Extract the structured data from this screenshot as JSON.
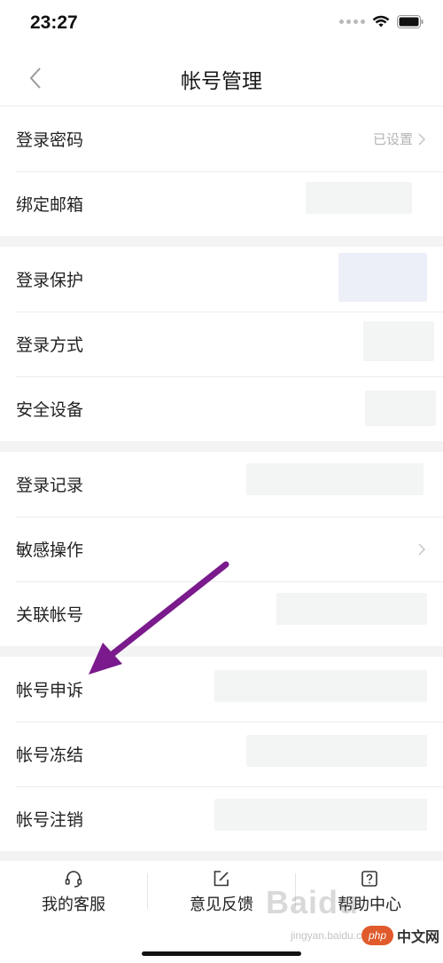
{
  "status_bar": {
    "time": "23:27"
  },
  "nav": {
    "title": "帐号管理"
  },
  "groups": [
    {
      "rows": [
        {
          "label": "登录密码",
          "value": "已设置"
        },
        {
          "label": "绑定邮箱"
        }
      ]
    },
    {
      "rows": [
        {
          "label": "登录保护"
        },
        {
          "label": "登录方式"
        },
        {
          "label": "安全设备"
        }
      ]
    },
    {
      "rows": [
        {
          "label": "登录记录"
        },
        {
          "label": "敏感操作"
        },
        {
          "label": "关联帐号"
        }
      ]
    },
    {
      "rows": [
        {
          "label": "帐号申诉"
        },
        {
          "label": "帐号冻结"
        },
        {
          "label": "帐号注销"
        }
      ]
    }
  ],
  "tab_bar": {
    "items": [
      {
        "label": "我的客服",
        "icon": "headset-icon"
      },
      {
        "label": "意见反馈",
        "icon": "edit-icon"
      },
      {
        "label": "帮助中心",
        "icon": "help-icon"
      }
    ]
  },
  "watermarks": {
    "baidu": "Baidu",
    "jingyan": "jingyan.baidu.com",
    "php_badge": "php",
    "php_text": "中文网"
  },
  "colors": {
    "arrow": "#7a1a8c",
    "separator": "#f3f3f3",
    "value_gray": "#b4b4b4"
  }
}
